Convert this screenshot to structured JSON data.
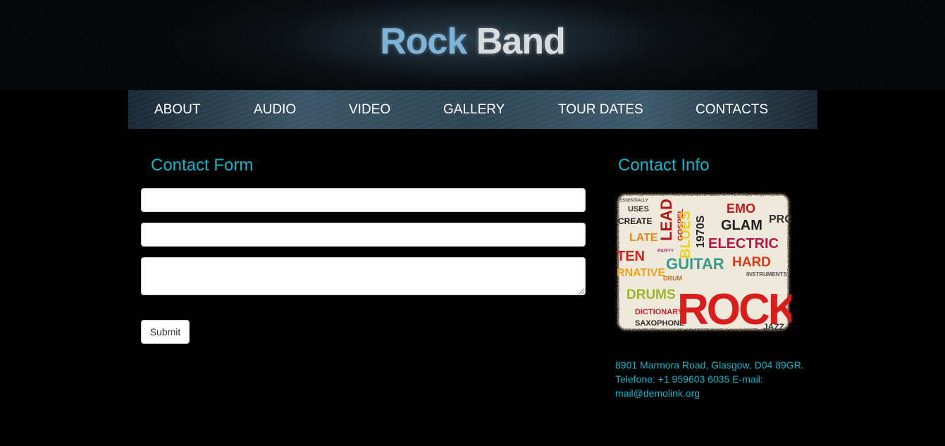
{
  "header": {
    "logo_word1": "Rock",
    "logo_word2": "Band"
  },
  "nav": {
    "items": [
      "ABOUT",
      "AUDIO",
      "VIDEO",
      "GALLERY",
      "TOUR DATES",
      "CONTACTS"
    ]
  },
  "contact_form": {
    "title": "Contact Form",
    "name_value": "",
    "email_value": "",
    "message_value": "",
    "submit_label": "Submit"
  },
  "contact_info": {
    "title": "Contact Info",
    "image_words": [
      "ESSENTIALLY",
      "USES",
      "CREATE",
      "LATE",
      "TEN",
      "RNATIVE",
      "DRUMS",
      "DICTIONARY",
      "SAXOPHONE",
      "LEAD",
      "GOSPEL",
      "BLUES",
      "1970S",
      "EMO",
      "PRO",
      "GLAM",
      "ELECTRIC",
      "GUITAR",
      "HARD",
      "ROCK",
      "JAZZ",
      "INSTRUMENTS",
      "PARTY",
      "DRUM"
    ],
    "address": "8901 Marmora Road, Glasgow, D04 89GR.",
    "telephone": "Telefone: +1 959603 6035 E-mail:",
    "email": "mail@demolink.org"
  },
  "colors": {
    "accent": "#12b5c8",
    "background": "#000000",
    "logo_blue": "#7fb3d6",
    "logo_silver": "#d9dde0"
  }
}
